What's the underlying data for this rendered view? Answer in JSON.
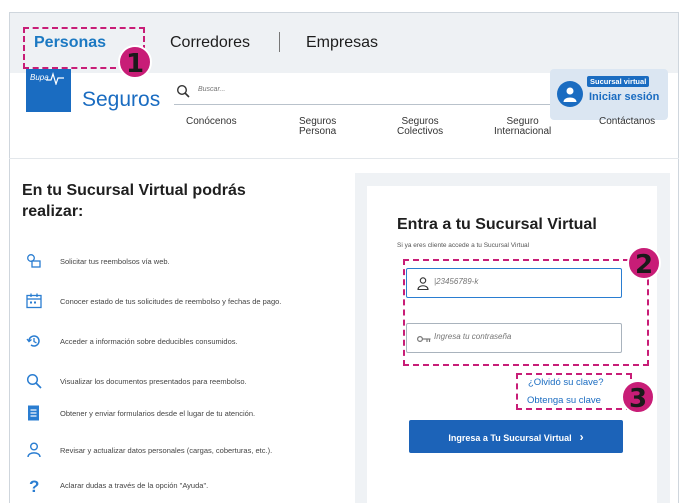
{
  "tabs": [
    {
      "label": "Personas",
      "active": true
    },
    {
      "label": "Corredores"
    },
    {
      "label": "Empresas"
    }
  ],
  "header": {
    "logo_brand": "Bupa",
    "logo_text": "Seguros",
    "search_placeholder": "Buscar...",
    "login_badge": "Sucursal virtual",
    "login_label": "Iniciar sesión"
  },
  "nav": [
    "Conócenos",
    "Seguros\nPersona",
    "Seguros\nColectivos",
    "Seguro\nInternacional",
    "Contáctanos"
  ],
  "left": {
    "title": "En tu Sucursal Virtual podrás realizar:",
    "features": [
      {
        "icon": "reimbursement-icon",
        "text": "Solicitar tus reembolsos vía web."
      },
      {
        "icon": "calendar-icon",
        "text": "Conocer estado de tus solicitudes de reembolso y fechas de pago."
      },
      {
        "icon": "history-icon",
        "text": "Acceder a información sobre deducibles consumidos."
      },
      {
        "icon": "search-icon",
        "text": "Visualizar los documentos presentados para reembolso."
      },
      {
        "icon": "form-icon",
        "text": "Obtener y enviar formularios desde el lugar de tu atención."
      },
      {
        "icon": "user-icon",
        "text": "Revisar y actualizar datos personales (cargas, coberturas, etc.)."
      },
      {
        "icon": "help-icon",
        "text": "Aclarar dudas a través de la opción \"Ayuda\"."
      }
    ]
  },
  "login": {
    "title": "Entra a tu Sucursal Virtual",
    "subtitle": "Si ya eres cliente accede a tu Sucursal Virtual",
    "rut_placeholder": "|23456789-k",
    "password_placeholder": "Ingresa tu contraseña",
    "forgot_link": "¿Olvidó su clave?",
    "get_link": "Obtenga su clave",
    "submit_label": "Ingresa a Tu Sucursal Virtual",
    "submit_chevron": "›"
  },
  "annotations": [
    "1",
    "2",
    "3"
  ],
  "colors": {
    "brand": "#1a6cc1",
    "annotation": "#c81d77",
    "button": "#1c63b8"
  }
}
